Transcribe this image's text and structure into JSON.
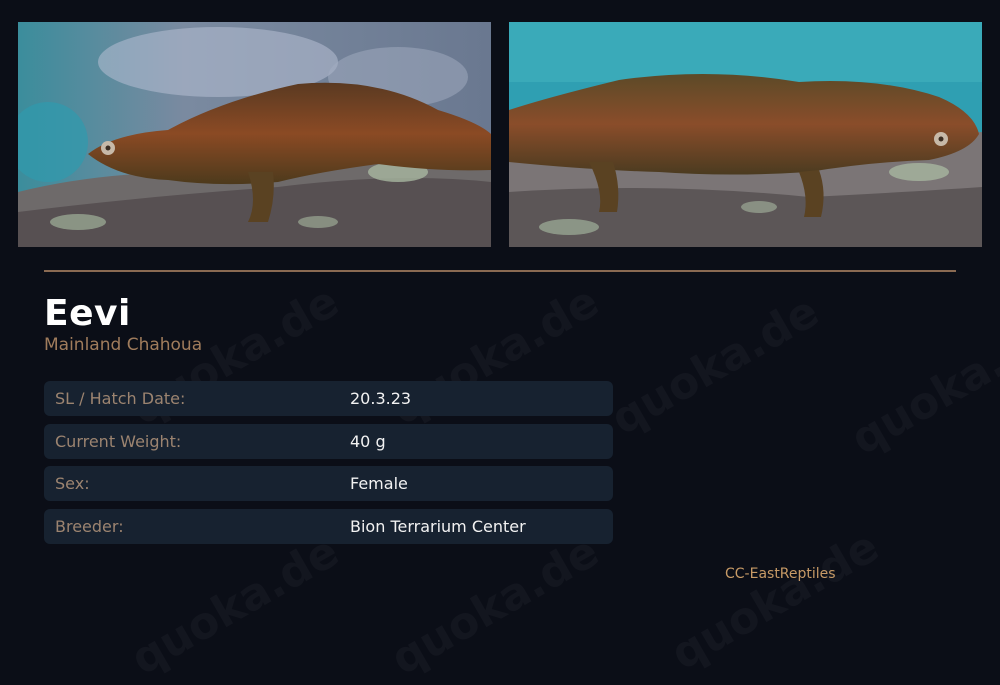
{
  "animal": {
    "name": "Eevi",
    "species": "Mainland Chahoua"
  },
  "details": [
    {
      "label": "SL / Hatch Date:",
      "value": "20.3.23"
    },
    {
      "label": "Current Weight:",
      "value": "40 g"
    },
    {
      "label": "Sex:",
      "value": "Female"
    },
    {
      "label": "Breeder:",
      "value": "Bion Terrarium Center"
    }
  ],
  "credit": "CC-EastReptiles",
  "watermark": "quoka.de",
  "colors": {
    "background": "#0b0e17",
    "accent": "#8a6a52",
    "row_background": "#172230",
    "label": "#9c8470",
    "credit": "#c79a66"
  }
}
